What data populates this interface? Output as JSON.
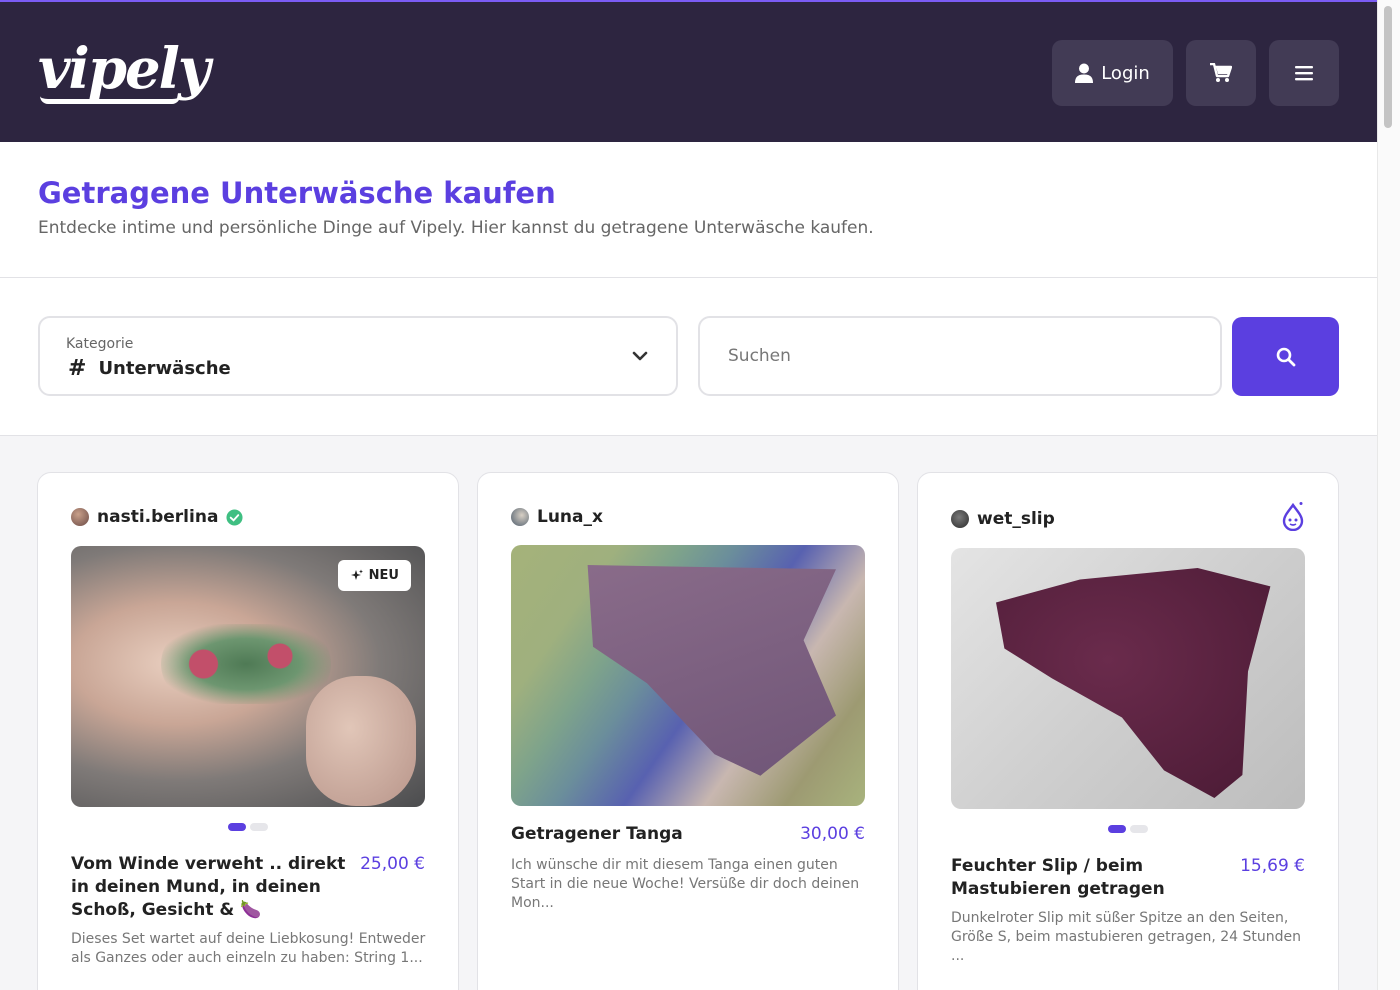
{
  "header": {
    "logo": "vipely",
    "login_label": "Login",
    "icons": {
      "user": "user-icon",
      "cart": "cart-icon",
      "menu": "hamburger-menu-icon"
    }
  },
  "intro": {
    "title": "Getragene Unterwäsche kaufen",
    "subtitle": "Entdecke intime und persönliche Dinge auf Vipely. Hier kannst du getragene Unterwäsche kaufen."
  },
  "filters": {
    "category_label": "Kategorie",
    "category_value": "Unterwäsche",
    "category_prefix": "#",
    "search_placeholder": "Suchen"
  },
  "colors": {
    "brand": "#5b3fe0",
    "header_bg": "#2d2540",
    "verified": "#3fbf82"
  },
  "products": [
    {
      "seller": "nasti.berlina",
      "verified": true,
      "badge": "NEU",
      "title": "Vom Winde verweht .. direkt in deinen Mund, in deinen Schoß, Gesicht & 🍆",
      "price": "25,00 €",
      "description": "Dieses Set wartet auf deine Liebkosung! Entweder als Ganzes oder auch einzeln zu haben: String 1..."
    },
    {
      "seller": "Luna_x",
      "verified": false,
      "title": "Getragener Tanga",
      "price": "30,00 €",
      "description": "Ich wünsche dir mit diesem Tanga einen guten Start in die neue Woche! Versüße dir doch deinen Mon..."
    },
    {
      "seller": "wet_slip",
      "verified": false,
      "title": "Feuchter Slip / beim Mastubieren getragen",
      "price": "15,69 €",
      "description": "Dunkelroter Slip mit süßer Spitze an den Seiten, Größe S, beim mastubieren getragen, 24 Stunden ..."
    }
  ]
}
